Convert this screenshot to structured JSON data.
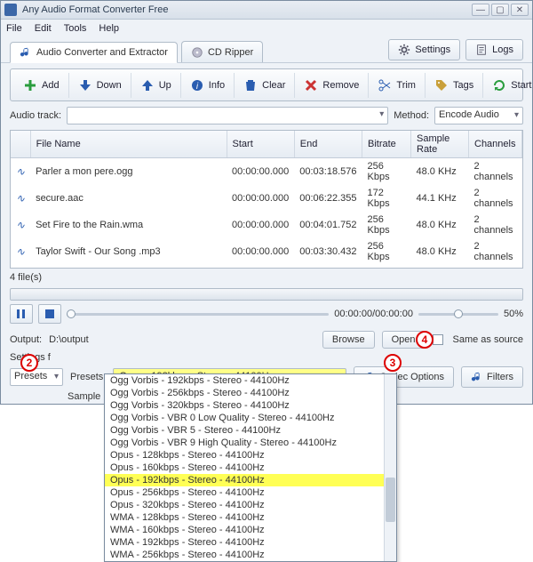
{
  "window": {
    "title": "Any Audio Format Converter Free"
  },
  "menu": {
    "file": "File",
    "edit": "Edit",
    "tools": "Tools",
    "help": "Help"
  },
  "tabs": {
    "converter": "Audio Converter and Extractor",
    "cd": "CD Ripper"
  },
  "topbtn": {
    "settings": "Settings",
    "logs": "Logs"
  },
  "toolbar": {
    "add": "Add",
    "down": "Down",
    "up": "Up",
    "info": "Info",
    "clear": "Clear",
    "remove": "Remove",
    "trim": "Trim",
    "tags": "Tags",
    "start": "Start"
  },
  "track": {
    "label": "Audio track:",
    "method_label": "Method:",
    "method_value": "Encode Audio"
  },
  "columns": {
    "name": "File Name",
    "start": "Start",
    "end": "End",
    "bitrate": "Bitrate",
    "sample": "Sample Rate",
    "channels": "Channels"
  },
  "rows": [
    {
      "name": "Parler a mon pere.ogg",
      "start": "00:00:00.000",
      "end": "00:03:18.576",
      "bitrate": "256 Kbps",
      "sample": "48.0 KHz",
      "channels": "2 channels"
    },
    {
      "name": "secure.aac",
      "start": "00:00:00.000",
      "end": "00:06:22.355",
      "bitrate": "172 Kbps",
      "sample": "44.1 KHz",
      "channels": "2 channels"
    },
    {
      "name": "Set Fire to the Rain.wma",
      "start": "00:00:00.000",
      "end": "00:04:01.752",
      "bitrate": "256 Kbps",
      "sample": "48.0 KHz",
      "channels": "2 channels"
    },
    {
      "name": "Taylor Swift - Our Song .mp3",
      "start": "00:00:00.000",
      "end": "00:03:30.432",
      "bitrate": "256 Kbps",
      "sample": "48.0 KHz",
      "channels": "2 channels"
    }
  ],
  "status": {
    "filecount": "4 file(s)"
  },
  "playback": {
    "time": "00:00:00/00:00:00",
    "volume": "50%"
  },
  "output": {
    "label": "Output:",
    "path": "D:\\output",
    "browse": "Browse",
    "open": "Open",
    "same": "Same as source"
  },
  "settings": {
    "label": "Settings f",
    "preset_label": "Presets:",
    "preset_type": "Presets",
    "preset_value": "Opus - 192kbps - Stereo - 44100Hz",
    "samplerates_label": "Sample rates:",
    "codec": "Codec Options",
    "filters": "Filters"
  },
  "dropdown": [
    "Ogg Vorbis - 192kbps - Stereo - 44100Hz",
    "Ogg Vorbis - 256kbps - Stereo - 44100Hz",
    "Ogg Vorbis - 320kbps - Stereo - 44100Hz",
    "Ogg Vorbis - VBR 0 Low Quality - Stereo - 44100Hz",
    "Ogg Vorbis - VBR 5 - Stereo - 44100Hz",
    "Ogg Vorbis - VBR 9 High Quality - Stereo - 44100Hz",
    "Opus - 128kbps - Stereo - 44100Hz",
    "Opus - 160kbps - Stereo - 44100Hz",
    "Opus - 192kbps - Stereo - 44100Hz",
    "Opus - 256kbps - Stereo - 44100Hz",
    "Opus - 320kbps - Stereo - 44100Hz",
    "WMA - 128kbps - Stereo - 44100Hz",
    "WMA - 160kbps - Stereo - 44100Hz",
    "WMA - 192kbps - Stereo - 44100Hz",
    "WMA - 256kbps - Stereo - 44100Hz"
  ],
  "dropdown_hl_index": 8,
  "annot": {
    "a2": "2",
    "a3": "3",
    "a4": "4"
  }
}
